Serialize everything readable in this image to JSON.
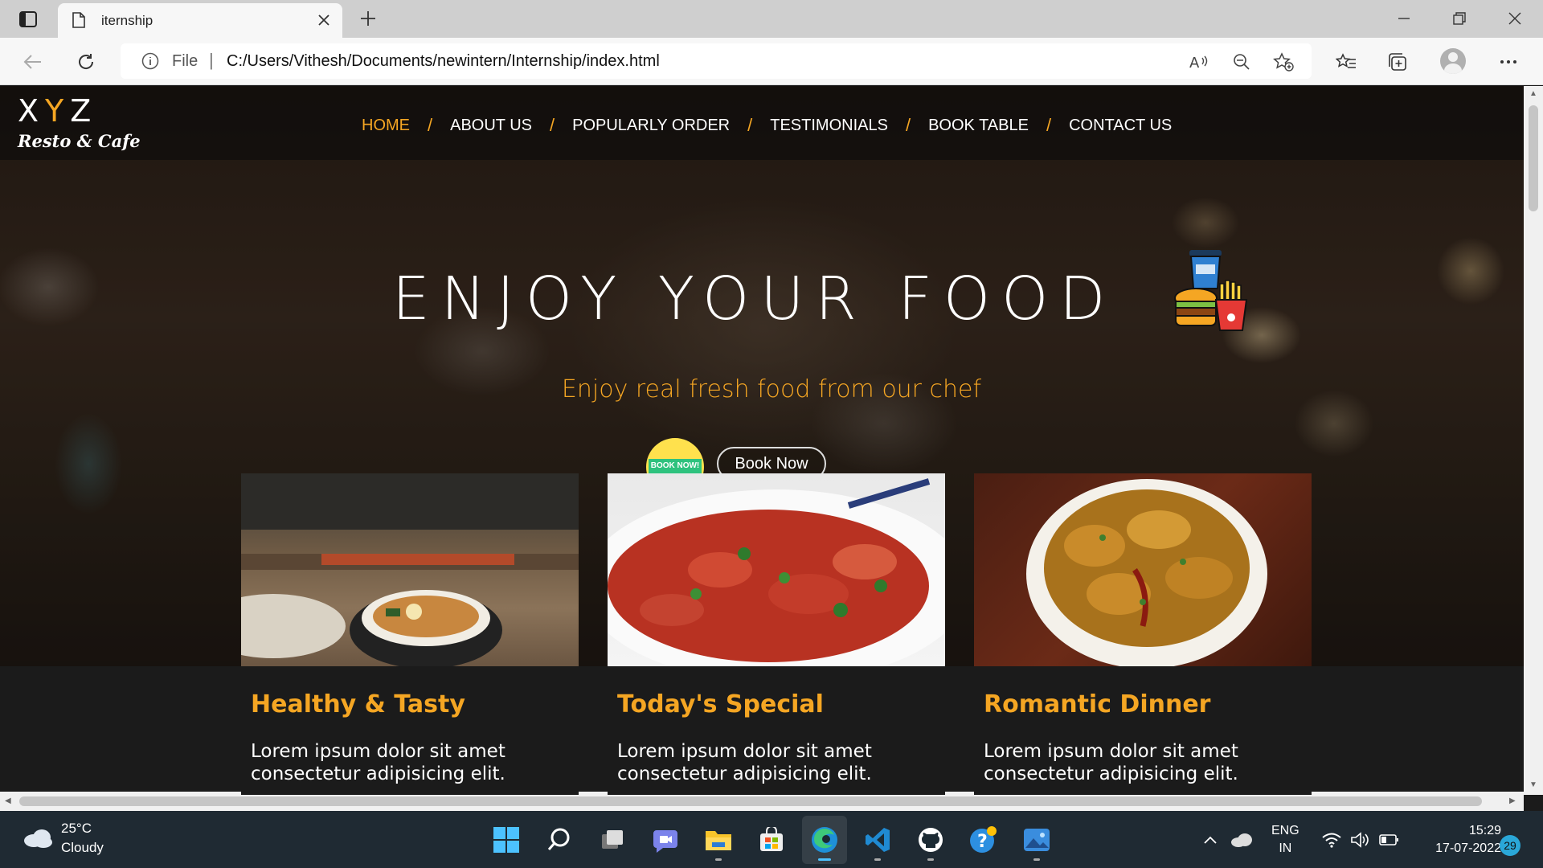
{
  "browser": {
    "tab_title": "iternship",
    "url_scheme": "File",
    "url": "C:/Users/Vithesh/Documents/newintern/Internship/index.html"
  },
  "site": {
    "logo_main": "XYZ",
    "logo_sub": "Resto & Cafe",
    "nav": [
      {
        "label": "HOME",
        "active": true
      },
      {
        "label": "ABOUT US"
      },
      {
        "label": "POPULARLY ORDER"
      },
      {
        "label": "TESTIMONIALS"
      },
      {
        "label": "BOOK TABLE"
      },
      {
        "label": "CONTACT US"
      }
    ],
    "nav_separator": "/",
    "hero_title": "ENJOY YOUR FOOD",
    "hero_subtitle": "Enjoy real fresh food from our chef",
    "book_badge_text": "BOOK NOW!",
    "book_button": "Book Now",
    "cards": [
      {
        "title": "Healthy & Tasty",
        "text": "Lorem ipsum dolor sit amet consectetur adipisicing elit."
      },
      {
        "title": "Today's Special",
        "text": "Lorem ipsum dolor sit amet consectetur adipisicing elit."
      },
      {
        "title": "Romantic Dinner",
        "text": "Lorem ipsum dolor sit amet consectetur adipisicing elit."
      }
    ]
  },
  "colors": {
    "accent": "#f5a623",
    "dark_band": "#1b1b1b",
    "taskbar": "#1f2a33"
  },
  "taskbar": {
    "temperature": "25°C",
    "weather": "Cloudy",
    "lang_line1": "ENG",
    "lang_line2": "IN",
    "time": "15:29",
    "date": "17-07-2022",
    "notifications": "29",
    "apps": [
      "start-icon",
      "search-icon",
      "task-view-icon",
      "teams-chat-icon",
      "file-explorer-icon",
      "store-icon",
      "edge-icon",
      "vscode-icon",
      "github-icon",
      "help-icon",
      "photos-icon"
    ]
  }
}
